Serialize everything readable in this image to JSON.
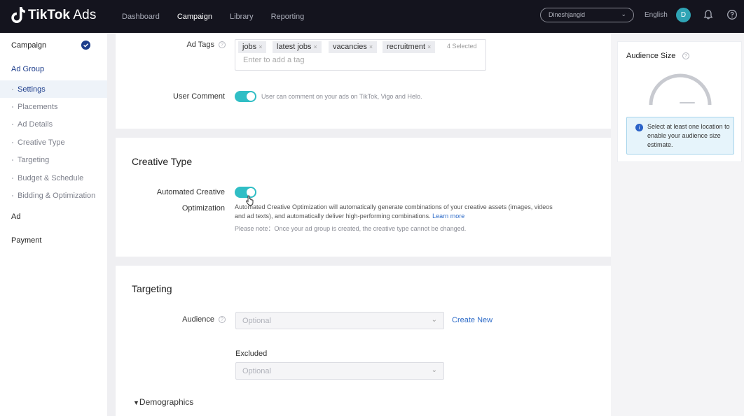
{
  "brand": {
    "name_bold": "TikTok",
    "name_light": " Ads"
  },
  "nav": {
    "items": [
      "Dashboard",
      "Campaign",
      "Library",
      "Reporting"
    ],
    "active": "Campaign"
  },
  "account": {
    "name": "Dineshjangid"
  },
  "language": "English",
  "avatar_initial": "D",
  "sidebar": {
    "steps": {
      "campaign": "Campaign",
      "ad_group": "Ad Group",
      "ad": "Ad",
      "payment": "Payment"
    },
    "substeps": [
      "Settings",
      "Placements",
      "Ad Details",
      "Creative Type",
      "Targeting",
      "Budget & Schedule",
      "Bidding & Optimization"
    ]
  },
  "ad_tags": {
    "label": "Ad Tags",
    "tags": [
      "jobs",
      "latest jobs",
      "vacancies",
      "recruitment"
    ],
    "remove_glyph": "×",
    "count": "4 Selected",
    "placeholder": "Enter to add a tag"
  },
  "user_comment": {
    "label": "User Comment",
    "enabled": true,
    "hint": "User can comment on your ads on TikTok, Vigo and Helo."
  },
  "creative_type": {
    "title": "Creative Type",
    "aco_label_1": "Automated Creative",
    "aco_label_2": "Optimization",
    "enabled": true,
    "description": "Automated Creative Optimization will automatically generate combinations of your creative assets (images, videos and ad texts), and automatically deliver high-performing combinations.",
    "learn_more": "Learn more",
    "note": "Please note：Once your ad group is created, the creative type cannot be changed."
  },
  "targeting": {
    "title": "Targeting",
    "audience_label": "Audience",
    "audience_placeholder": "Optional",
    "create_new": "Create New",
    "excluded_label": "Excluded",
    "excluded_placeholder": "Optional",
    "demographics": "Demographics"
  },
  "audience_size": {
    "title": "Audience Size",
    "info": "Select at least one location to enable your audience size estimate."
  },
  "colors": {
    "topbar": "#14141e",
    "accent_blue": "#1e3e8c",
    "toggle_on": "#30bec5",
    "link": "#2d6bc8"
  }
}
